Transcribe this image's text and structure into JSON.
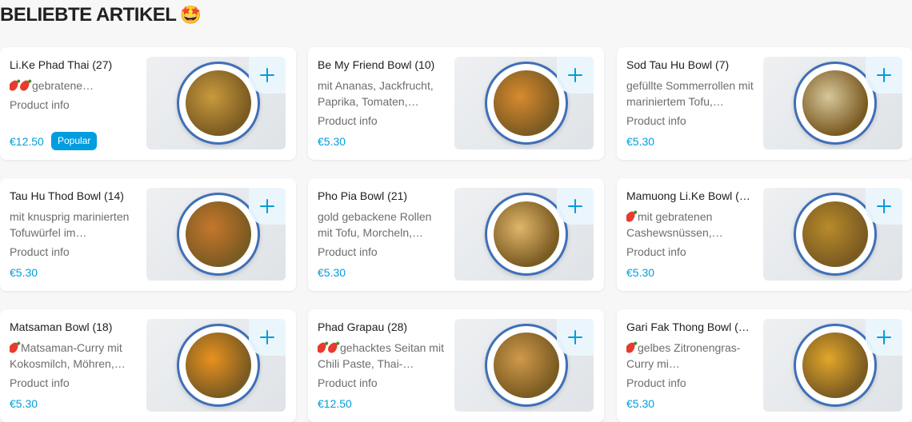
{
  "section": {
    "title": "BELIEBTE ARTIKEL",
    "emoji": "🤩"
  },
  "items": [
    {
      "name": "Li.Ke Phad Thai (27)",
      "desc": "gebratene…",
      "chili": 2,
      "info": "Product info",
      "price": "€12.50",
      "badge": "Popular",
      "foodColor": "#c99a3d"
    },
    {
      "name": "Be My Friend Bowl (10)",
      "desc": "mit Ananas, Jackfrucht, Paprika, Tomaten,…",
      "chili": 0,
      "info": "Product info",
      "price": "€5.30",
      "badge": "",
      "foodColor": "#d98a2e"
    },
    {
      "name": "Sod Tau Hu Bowl (7)",
      "desc": "gefüllte Sommerrollen mit mariniertem Tofu,…",
      "chili": 0,
      "info": "Product info",
      "price": "€5.30",
      "badge": "",
      "foodColor": "#d7c79a"
    },
    {
      "name": "Tau Hu Thod Bowl (14)",
      "desc": "mit knusprig marinierten Tofuwürfel im…",
      "chili": 0,
      "info": "Product info",
      "price": "€5.30",
      "badge": "",
      "foodColor": "#c5772c"
    },
    {
      "name": "Pho Pia Bowl (21)",
      "desc": "gold gebackene Rollen mit Tofu, Morcheln,…",
      "chili": 0,
      "info": "Product info",
      "price": "€5.30",
      "badge": "",
      "foodColor": "#e0b66a"
    },
    {
      "name": "Mamuong Li.Ke Bowl (…",
      "desc": "mit gebratenen Cashewsnüssen,…",
      "chili": 1,
      "info": "Product info",
      "price": "€5.30",
      "badge": "",
      "foodColor": "#b88a2a"
    },
    {
      "name": "Matsaman Bowl (18)",
      "desc": "Matsaman-Curry mit Kokosmilch, Möhren,…",
      "chili": 1,
      "info": "Product info",
      "price": "€5.30",
      "badge": "",
      "foodColor": "#e8921e"
    },
    {
      "name": "Phad Grapau (28)",
      "desc": "gehacktes Seitan mit Chili Paste, Thai-…",
      "chili": 2,
      "info": "Product info",
      "price": "€12.50",
      "badge": "",
      "foodColor": "#cf9a4a"
    },
    {
      "name": "Gari Fak Thong Bowl (…",
      "desc": "gelbes Zitronengras-Curry mi…",
      "chili": 1,
      "info": "Product info",
      "price": "€5.30",
      "badge": "",
      "foodColor": "#e2a72a"
    }
  ],
  "add_icon": "plus-icon",
  "accent": "#009de0"
}
